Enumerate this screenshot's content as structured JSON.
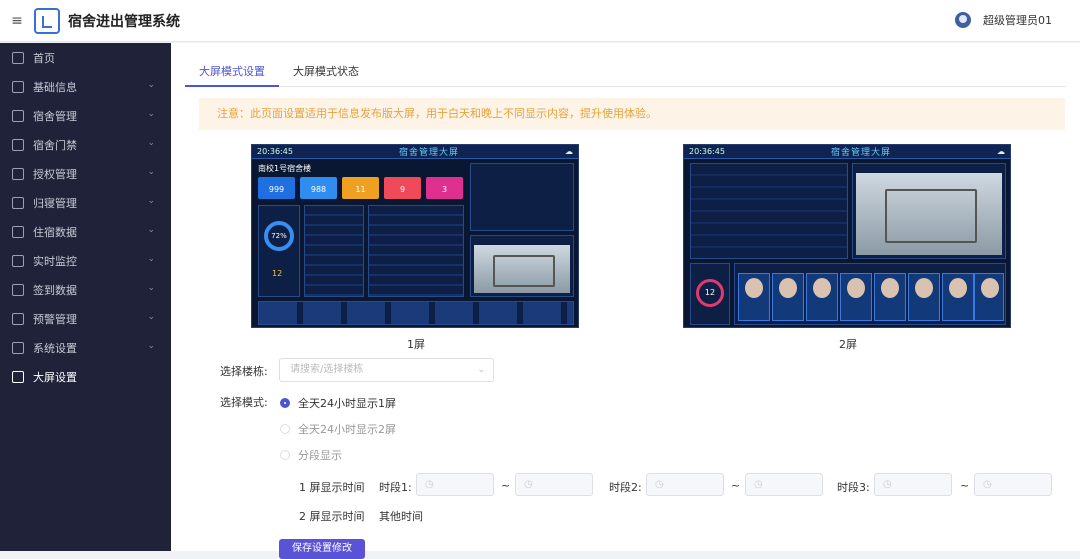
{
  "header": {
    "app_title": "宿舍进出管理系统",
    "user_name": "超级管理员01",
    "menu_icon": "hamburger-icon",
    "logo_icon": "app-logo"
  },
  "sidebar": {
    "items": [
      {
        "label": "首页",
        "icon": "home-icon",
        "expandable": false
      },
      {
        "label": "基础信息",
        "icon": "info-icon",
        "expandable": true
      },
      {
        "label": "宿舍管理",
        "icon": "dorm-icon",
        "expandable": true
      },
      {
        "label": "宿舍门禁",
        "icon": "door-icon",
        "expandable": true
      },
      {
        "label": "授权管理",
        "icon": "shield-icon",
        "expandable": true
      },
      {
        "label": "归寝管理",
        "icon": "house-icon",
        "expandable": true
      },
      {
        "label": "住宿数据",
        "icon": "data-icon",
        "expandable": true
      },
      {
        "label": "实时监控",
        "icon": "monitor-icon",
        "expandable": true
      },
      {
        "label": "签到数据",
        "icon": "edit-icon",
        "expandable": true
      },
      {
        "label": "预警管理",
        "icon": "alert-icon",
        "expandable": true
      },
      {
        "label": "系统设置",
        "icon": "gear-icon",
        "expandable": true
      },
      {
        "label": "大屏设置",
        "icon": "screen-icon",
        "expandable": false
      }
    ]
  },
  "tabs": [
    "大屏模式设置",
    "大屏模式状态"
  ],
  "notice": "注意：此页面设置适用于信息发布版大屏，用于白天和晚上不同显示内容，提升使用体验。",
  "screens": [
    {
      "caption": "1屏",
      "time": "20:36:45",
      "title": "宿舍管理大屏",
      "building": "南校1号宿舍楼",
      "stats": [
        "999",
        "988",
        "11",
        "9",
        "3"
      ],
      "percent": "72%",
      "count": "12"
    },
    {
      "caption": "2屏",
      "time": "20:36:45",
      "title": "宿舍管理大屏",
      "count": "12"
    }
  ],
  "form": {
    "building_label": "选择楼栋:",
    "building_placeholder": "请搜索/选择楼栋",
    "mode_label": "选择模式:",
    "modes": [
      "全天24小时显示1屏",
      "全天24小时显示2屏",
      "分段显示"
    ],
    "screen1_time_label": "1 屏显示时间",
    "screen2_time_label": "2 屏显示时间",
    "other_time": "其他时间",
    "period1": "时段1:",
    "period2": "时段2:",
    "period3": "时段3:",
    "tilde": "~",
    "submit": "保存设置修改"
  },
  "colors": {
    "accent": "#4c56d1",
    "sidebar_bg": "#1f2238",
    "notice_bg": "#fdf4e7",
    "notice_text": "#e6a23c"
  }
}
